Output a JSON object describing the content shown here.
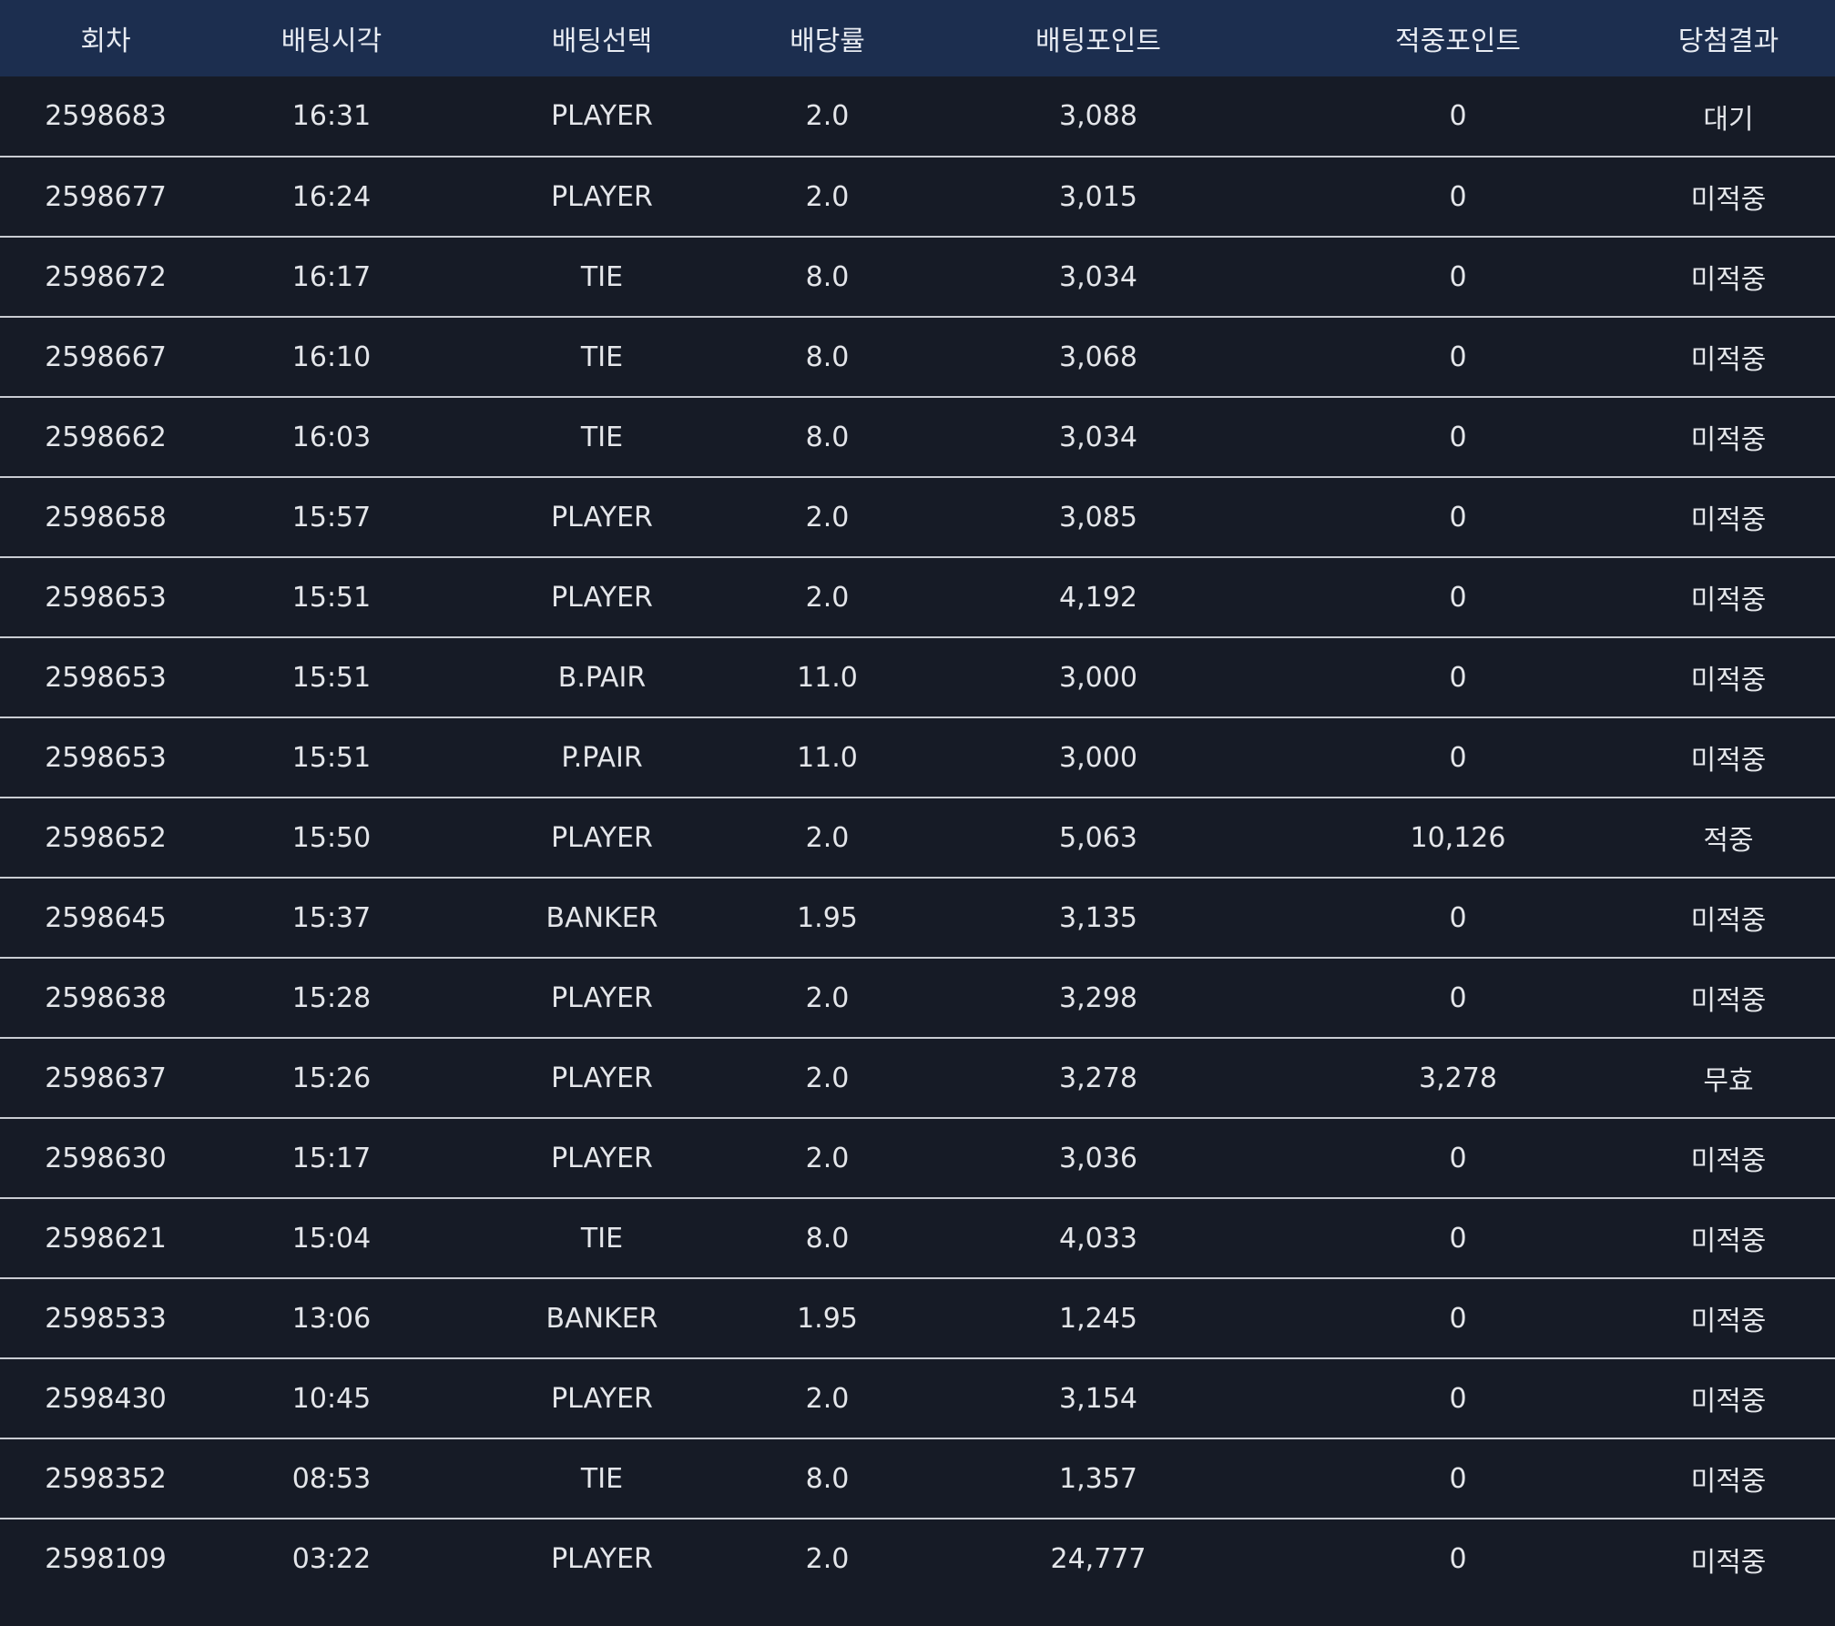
{
  "table": {
    "headers": [
      "회차",
      "배팅시각",
      "배팅선택",
      "배당률",
      "배팅포인트",
      "적중포인트",
      "당첨결과"
    ],
    "rows": [
      [
        "2598683",
        "16:31",
        "PLAYER",
        "2.0",
        "3,088",
        "0",
        "대기"
      ],
      [
        "2598677",
        "16:24",
        "PLAYER",
        "2.0",
        "3,015",
        "0",
        "미적중"
      ],
      [
        "2598672",
        "16:17",
        "TIE",
        "8.0",
        "3,034",
        "0",
        "미적중"
      ],
      [
        "2598667",
        "16:10",
        "TIE",
        "8.0",
        "3,068",
        "0",
        "미적중"
      ],
      [
        "2598662",
        "16:03",
        "TIE",
        "8.0",
        "3,034",
        "0",
        "미적중"
      ],
      [
        "2598658",
        "15:57",
        "PLAYER",
        "2.0",
        "3,085",
        "0",
        "미적중"
      ],
      [
        "2598653",
        "15:51",
        "PLAYER",
        "2.0",
        "4,192",
        "0",
        "미적중"
      ],
      [
        "2598653",
        "15:51",
        "B.PAIR",
        "11.0",
        "3,000",
        "0",
        "미적중"
      ],
      [
        "2598653",
        "15:51",
        "P.PAIR",
        "11.0",
        "3,000",
        "0",
        "미적중"
      ],
      [
        "2598652",
        "15:50",
        "PLAYER",
        "2.0",
        "5,063",
        "10,126",
        "적중"
      ],
      [
        "2598645",
        "15:37",
        "BANKER",
        "1.95",
        "3,135",
        "0",
        "미적중"
      ],
      [
        "2598638",
        "15:28",
        "PLAYER",
        "2.0",
        "3,298",
        "0",
        "미적중"
      ],
      [
        "2598637",
        "15:26",
        "PLAYER",
        "2.0",
        "3,278",
        "3,278",
        "무효"
      ],
      [
        "2598630",
        "15:17",
        "PLAYER",
        "2.0",
        "3,036",
        "0",
        "미적중"
      ],
      [
        "2598621",
        "15:04",
        "TIE",
        "8.0",
        "4,033",
        "0",
        "미적중"
      ],
      [
        "2598533",
        "13:06",
        "BANKER",
        "1.95",
        "1,245",
        "0",
        "미적중"
      ],
      [
        "2598430",
        "10:45",
        "PLAYER",
        "2.0",
        "3,154",
        "0",
        "미적중"
      ],
      [
        "2598352",
        "08:53",
        "TIE",
        "8.0",
        "1,357",
        "0",
        "미적중"
      ],
      [
        "2598109",
        "03:22",
        "PLAYER",
        "2.0",
        "24,777",
        "0",
        "미적중"
      ]
    ]
  },
  "colors": {
    "header_background": "#1c2e4f",
    "row_background": "#161b26",
    "divider": "#c9ccd2",
    "text": "#e4e6ea"
  }
}
